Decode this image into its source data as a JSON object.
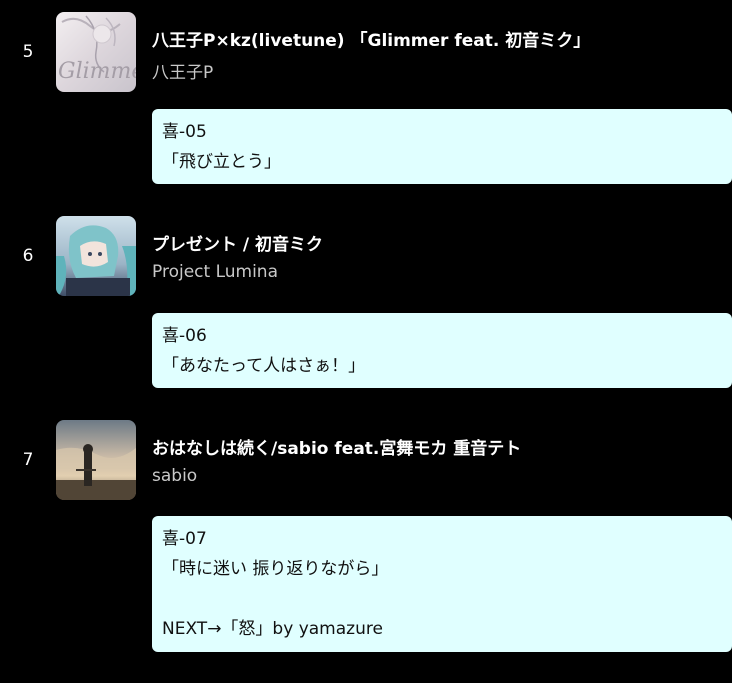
{
  "theme": {
    "background": "#000000",
    "comment_background": "#e0ffff",
    "artist_color": "#c8c8c8"
  },
  "tracks": [
    {
      "number": "5",
      "title": "八王子P×kz(livetune) 「Glimmer feat. 初音ミク」",
      "artist": "八王子P",
      "artwork": {
        "icon": "album-art-glimmer",
        "text": "Glimme"
      },
      "comment": [
        "喜-05",
        "「飛び立とう」"
      ]
    },
    {
      "number": "6",
      "title": "プレゼント / 初音ミク",
      "artist": "Project Lumina",
      "artwork": {
        "icon": "album-art-present"
      },
      "comment": [
        "喜-06",
        "「あなたって人はさぁ！」"
      ]
    },
    {
      "number": "7",
      "title": "おはなしは続く/sabio feat.宮舞モカ 重音テト",
      "artist": "sabio",
      "artwork": {
        "icon": "album-art-ohanashi"
      },
      "comment": [
        "喜-07",
        "「時に迷い 振り返りながら」",
        "",
        "NEXT→「怒」by yamazure"
      ]
    }
  ]
}
